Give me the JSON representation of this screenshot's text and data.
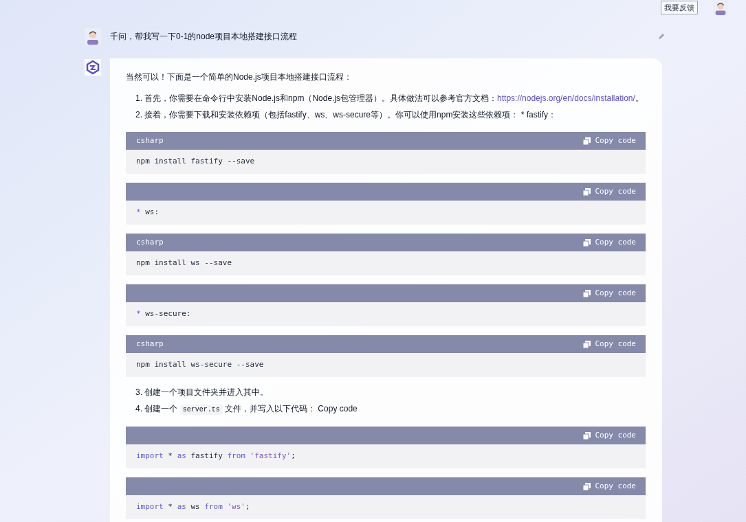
{
  "header": {
    "feedback_button": "我要反馈"
  },
  "question": {
    "text": "千问，帮我写一下0-1的node项目本地搭建接口流程"
  },
  "answer": {
    "content": [
      {
        "kind": "paragraph",
        "parts": [
          {
            "kind": "text",
            "text": "当然可以！下面是一个简单的Node.js项目本地搭建接口流程："
          }
        ]
      },
      {
        "kind": "list_item",
        "number": "1.",
        "parts": [
          {
            "kind": "text",
            "text": "首先，你需要在命令行中安装Node.js和npm（Node.js包管理器）。具体做法可以参考官方文档："
          },
          {
            "kind": "link",
            "text": "https://nodejs.org/en/docs/installation/"
          },
          {
            "kind": "text",
            "text": "。"
          }
        ]
      },
      {
        "kind": "list_item",
        "number": "2.",
        "parts": [
          {
            "kind": "text",
            "text": "接着，你需要下载和安装依赖项（包括fastify、ws、ws-secure等）。你可以使用npm安装这些依赖项： * fastify："
          }
        ]
      },
      {
        "kind": "code_block",
        "language": "csharp",
        "copy_label": "Copy code",
        "tokens": [
          {
            "kind": "plain",
            "text": "npm install fastify --save"
          }
        ]
      },
      {
        "kind": "code_block",
        "copy_label": "Copy code",
        "tokens": [
          {
            "kind": "keyword",
            "text": "*"
          },
          {
            "kind": "plain",
            "text": " ws:"
          }
        ]
      },
      {
        "kind": "code_block",
        "language": "csharp",
        "copy_label": "Copy code",
        "tokens": [
          {
            "kind": "plain",
            "text": "npm install ws --save"
          }
        ]
      },
      {
        "kind": "code_block",
        "copy_label": "Copy code",
        "tokens": [
          {
            "kind": "keyword",
            "text": "*"
          },
          {
            "kind": "plain",
            "text": " ws-secure:"
          }
        ]
      },
      {
        "kind": "code_block",
        "language": "csharp",
        "copy_label": "Copy code",
        "tokens": [
          {
            "kind": "plain",
            "text": "npm install ws-secure --save"
          }
        ]
      },
      {
        "kind": "list_item",
        "number": "3.",
        "parts": [
          {
            "kind": "text",
            "text": "创建一个项目文件夹并进入其中。"
          }
        ]
      },
      {
        "kind": "list_item",
        "number": "4.",
        "parts": [
          {
            "kind": "text",
            "text": "创建一个 "
          },
          {
            "kind": "code",
            "text": "server.ts"
          },
          {
            "kind": "text",
            "text": " 文件，并写入以下代码： Copy code"
          }
        ]
      },
      {
        "kind": "code_block",
        "copy_label": "Copy code",
        "tokens": [
          {
            "kind": "keyword",
            "text": "import"
          },
          {
            "kind": "plain",
            "text": " * "
          },
          {
            "kind": "keyword",
            "text": "as"
          },
          {
            "kind": "plain",
            "text": " fastify "
          },
          {
            "kind": "keyword",
            "text": "from "
          },
          {
            "kind": "string",
            "text": "'fastify'"
          },
          {
            "kind": "plain",
            "text": ";"
          }
        ]
      },
      {
        "kind": "code_block",
        "copy_label": "Copy code",
        "tokens": [
          {
            "kind": "keyword",
            "text": "import"
          },
          {
            "kind": "plain",
            "text": " * "
          },
          {
            "kind": "keyword",
            "text": "as"
          },
          {
            "kind": "plain",
            "text": " ws "
          },
          {
            "kind": "keyword",
            "text": "from "
          },
          {
            "kind": "string",
            "text": "'ws'"
          },
          {
            "kind": "plain",
            "text": ";"
          }
        ]
      }
    ]
  }
}
